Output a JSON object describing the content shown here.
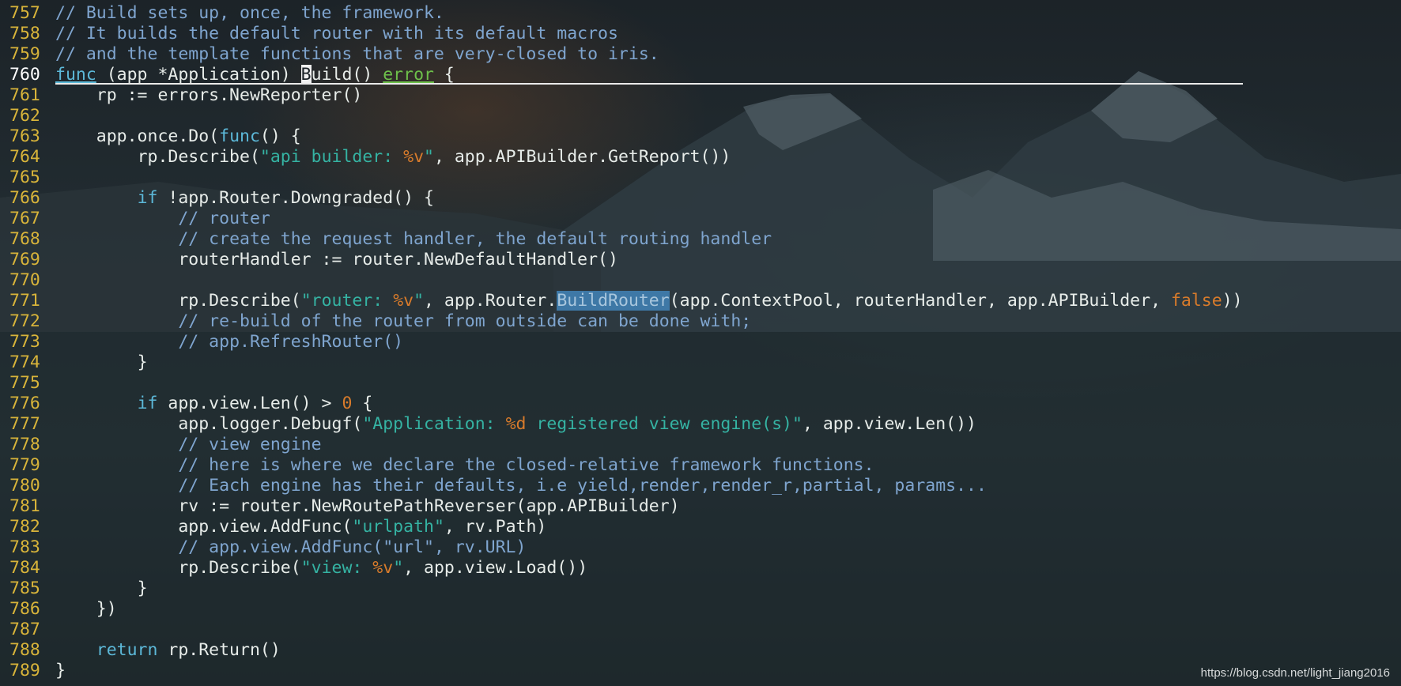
{
  "editor": {
    "current_line": "760",
    "lines": [
      {
        "n": "757",
        "indent": "",
        "parts": [
          {
            "t": "// Build sets up, once, the framework.",
            "c": "cm"
          }
        ]
      },
      {
        "n": "758",
        "indent": "",
        "parts": [
          {
            "t": "// It builds the default router with its default macros",
            "c": "cm"
          }
        ]
      },
      {
        "n": "759",
        "indent": "",
        "parts": [
          {
            "t": "// and the template functions that are very-closed to iris.",
            "c": "cm"
          }
        ]
      },
      {
        "n": "760",
        "indent": "",
        "parts": [
          {
            "t": "func",
            "c": "kw ul"
          },
          {
            "t": " (app *Application) "
          },
          {
            "t": "B",
            "c": "cur"
          },
          {
            "t": "uild() "
          },
          {
            "t": "error",
            "c": "ty"
          },
          {
            "t": " {"
          }
        ]
      },
      {
        "n": "761",
        "indent": "    ",
        "parts": [
          {
            "t": "rp := errors.NewReporter()"
          }
        ]
      },
      {
        "n": "762",
        "indent": "",
        "parts": []
      },
      {
        "n": "763",
        "indent": "    ",
        "parts": [
          {
            "t": "app.once.Do("
          },
          {
            "t": "func",
            "c": "kw"
          },
          {
            "t": "() {"
          }
        ]
      },
      {
        "n": "764",
        "indent": "        ",
        "parts": [
          {
            "t": "rp.Describe("
          },
          {
            "t": "\"api builder: ",
            "c": "st"
          },
          {
            "t": "%v",
            "c": "fmt"
          },
          {
            "t": "\"",
            "c": "st"
          },
          {
            "t": ", app.APIBuilder.GetReport())"
          }
        ]
      },
      {
        "n": "765",
        "indent": "",
        "parts": []
      },
      {
        "n": "766",
        "indent": "        ",
        "parts": [
          {
            "t": "if",
            "c": "kw"
          },
          {
            "t": " !app.Router.Downgraded() {"
          }
        ]
      },
      {
        "n": "767",
        "indent": "            ",
        "parts": [
          {
            "t": "// router",
            "c": "cm"
          }
        ]
      },
      {
        "n": "768",
        "indent": "            ",
        "parts": [
          {
            "t": "// create the request handler, the default routing handler",
            "c": "cm"
          }
        ]
      },
      {
        "n": "769",
        "indent": "            ",
        "parts": [
          {
            "t": "routerHandler := router.NewDefaultHandler()"
          }
        ]
      },
      {
        "n": "770",
        "indent": "",
        "parts": []
      },
      {
        "n": "771",
        "indent": "            ",
        "parts": [
          {
            "t": "rp.Describe("
          },
          {
            "t": "\"router: ",
            "c": "st"
          },
          {
            "t": "%v",
            "c": "fmt"
          },
          {
            "t": "\"",
            "c": "st"
          },
          {
            "t": ", app.Router."
          },
          {
            "t": "BuildRouter",
            "c": "hl"
          },
          {
            "t": "(app.ContextPool, routerHandler, app.APIBuilder, "
          },
          {
            "t": "false",
            "c": "num"
          },
          {
            "t": "))"
          }
        ]
      },
      {
        "n": "772",
        "indent": "            ",
        "parts": [
          {
            "t": "// re-build of the router from outside can be done with;",
            "c": "cm"
          }
        ]
      },
      {
        "n": "773",
        "indent": "            ",
        "parts": [
          {
            "t": "// app.RefreshRouter()",
            "c": "cm"
          }
        ]
      },
      {
        "n": "774",
        "indent": "        ",
        "parts": [
          {
            "t": "}"
          }
        ]
      },
      {
        "n": "775",
        "indent": "",
        "parts": []
      },
      {
        "n": "776",
        "indent": "        ",
        "parts": [
          {
            "t": "if",
            "c": "kw"
          },
          {
            "t": " app.view.Len() > "
          },
          {
            "t": "0",
            "c": "num"
          },
          {
            "t": " {"
          }
        ]
      },
      {
        "n": "777",
        "indent": "            ",
        "parts": [
          {
            "t": "app.logger.Debugf("
          },
          {
            "t": "\"Application: ",
            "c": "st"
          },
          {
            "t": "%d",
            "c": "fmt"
          },
          {
            "t": " registered view engine(s)\"",
            "c": "st"
          },
          {
            "t": ", app.view.Len())"
          }
        ]
      },
      {
        "n": "778",
        "indent": "            ",
        "parts": [
          {
            "t": "// view engine",
            "c": "cm"
          }
        ]
      },
      {
        "n": "779",
        "indent": "            ",
        "parts": [
          {
            "t": "// here is where we declare the closed-relative framework functions.",
            "c": "cm"
          }
        ]
      },
      {
        "n": "780",
        "indent": "            ",
        "parts": [
          {
            "t": "// Each engine has their defaults, i.e yield,render,render_r,partial, params...",
            "c": "cm"
          }
        ]
      },
      {
        "n": "781",
        "indent": "            ",
        "parts": [
          {
            "t": "rv := router.NewRoutePathReverser(app.APIBuilder)"
          }
        ]
      },
      {
        "n": "782",
        "indent": "            ",
        "parts": [
          {
            "t": "app.view.AddFunc("
          },
          {
            "t": "\"urlpath\"",
            "c": "st"
          },
          {
            "t": ", rv.Path)"
          }
        ]
      },
      {
        "n": "783",
        "indent": "            ",
        "parts": [
          {
            "t": "// app.view.AddFunc(\"url\", rv.URL)",
            "c": "cm"
          }
        ]
      },
      {
        "n": "784",
        "indent": "            ",
        "parts": [
          {
            "t": "rp.Describe("
          },
          {
            "t": "\"view: ",
            "c": "st"
          },
          {
            "t": "%v",
            "c": "fmt"
          },
          {
            "t": "\"",
            "c": "st"
          },
          {
            "t": ", app.view.Load())"
          }
        ]
      },
      {
        "n": "785",
        "indent": "        ",
        "parts": [
          {
            "t": "}"
          }
        ]
      },
      {
        "n": "786",
        "indent": "    ",
        "parts": [
          {
            "t": "})"
          }
        ]
      },
      {
        "n": "787",
        "indent": "",
        "parts": []
      },
      {
        "n": "788",
        "indent": "    ",
        "parts": [
          {
            "t": "return",
            "c": "kw"
          },
          {
            "t": " rp.Return()"
          }
        ]
      },
      {
        "n": "789",
        "indent": "",
        "parts": [
          {
            "t": "}"
          }
        ]
      }
    ]
  },
  "watermark": "https://blog.csdn.net/light_jiang2016"
}
